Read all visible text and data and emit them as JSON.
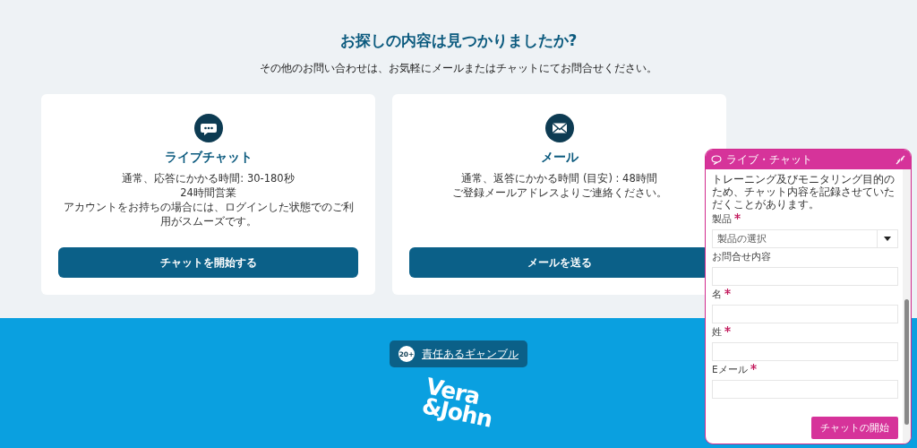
{
  "heading": "お探しの内容は見つかりましたか?",
  "subheading": "その他のお問い合わせは、お気軽にメールまたはチャットにてお問合せください。",
  "cards": [
    {
      "kind": "chat",
      "title": "ライブチャット",
      "lines": [
        "通常、応答にかかる時間: 30-180秒",
        "24時間営業",
        "アカウントをお持ちの場合には、ログインした状態でのご利用がスムーズです。"
      ],
      "button": "チャットを開始する"
    },
    {
      "kind": "mail",
      "title": "メール",
      "lines": [
        "通常、返答にかかる時間 (目安) : 48時間",
        "ご登録メールアドレスよりご連絡ください。"
      ],
      "button": "メールを送る"
    }
  ],
  "footer": {
    "age_badge": "20+",
    "responsible_link": "責任あるギャンブル",
    "logo_top": "Vera",
    "logo_bottom": "&John"
  },
  "chat_widget": {
    "title": "ライブ・チャット",
    "notice": "トレーニング及びモニタリング目的のため、チャット内容を記録させていただくことがあります。",
    "fields": [
      {
        "kind": "select",
        "label": "製品",
        "required": true,
        "placeholder": "製品の選択"
      },
      {
        "kind": "text",
        "label": "お問合せ内容",
        "required": false
      },
      {
        "kind": "text",
        "label": "名",
        "required": true
      },
      {
        "kind": "text",
        "label": "姓",
        "required": true
      },
      {
        "kind": "text",
        "label": "Eメール",
        "required": true
      }
    ],
    "submit": "チャットの開始"
  }
}
